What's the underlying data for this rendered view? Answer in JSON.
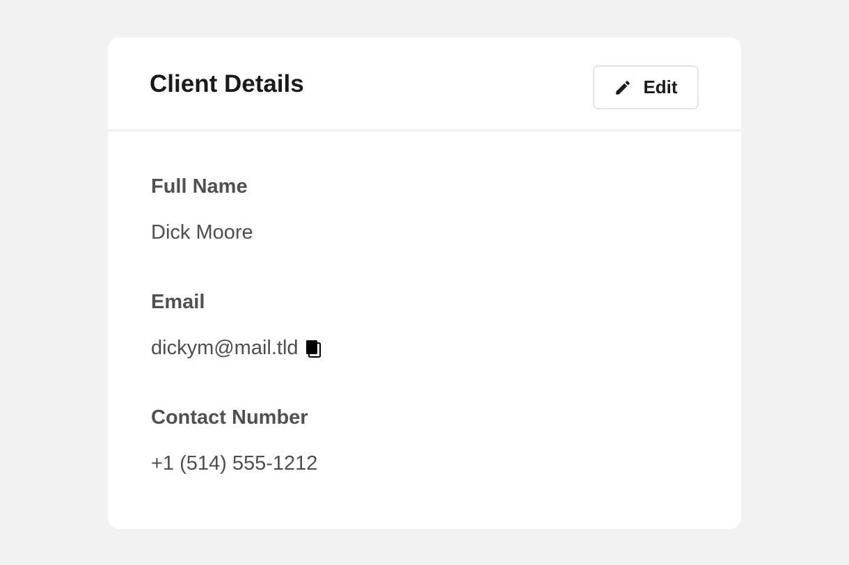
{
  "card": {
    "title": "Client Details",
    "edit_label": "Edit"
  },
  "fields": {
    "full_name": {
      "label": "Full Name",
      "value": "Dick Moore"
    },
    "email": {
      "label": "Email",
      "value": "dickym@mail.tld",
      "action_icon": "copy-icon"
    },
    "contact_number": {
      "label": "Contact Number",
      "value": "+1 (514) 555-1212"
    }
  },
  "icons": {
    "edit": "pencil-icon",
    "copy": "copy-icon"
  },
  "colors": {
    "page_background": "#f2f2f2",
    "card_background": "#ffffff",
    "title_text": "#1a1a1a",
    "label_text": "#505050",
    "value_text": "#4d4d4d"
  }
}
